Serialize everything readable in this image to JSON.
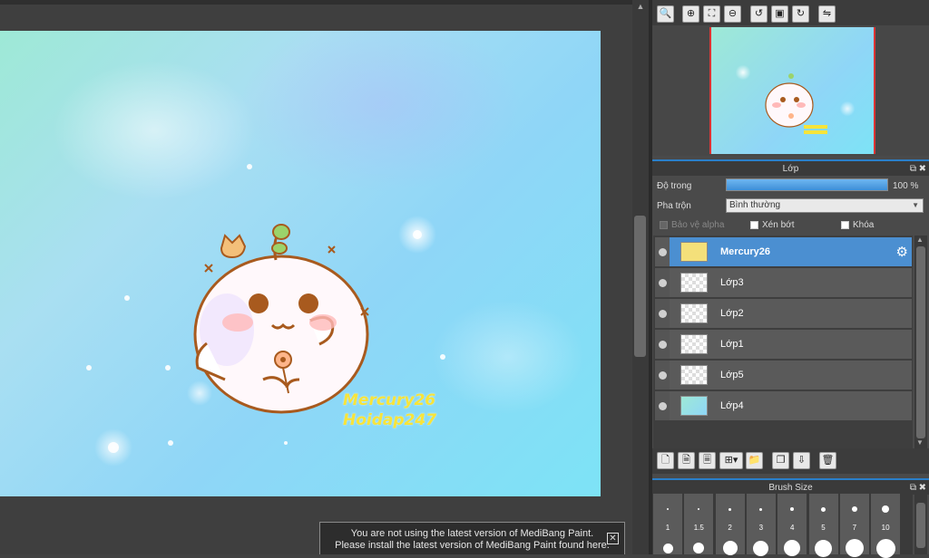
{
  "canvas": {
    "watermark_line1": "Mercury26",
    "watermark_line2": "Hoidap247",
    "background_colors": [
      "#9ee9d6",
      "#8fd6f7",
      "#7de3f6"
    ]
  },
  "navigator": {
    "tools": [
      {
        "name": "zoom-fit-icon",
        "glyph": "🔍"
      },
      {
        "name": "zoom-in-icon",
        "glyph": "⊕"
      },
      {
        "name": "fit-screen-icon",
        "glyph": "⛶"
      },
      {
        "name": "zoom-out-icon",
        "glyph": "⊖"
      },
      {
        "name": "rotate-left-icon",
        "glyph": "↺"
      },
      {
        "name": "actual-size-icon",
        "glyph": "▣"
      },
      {
        "name": "rotate-right-icon",
        "glyph": "↻"
      },
      {
        "name": "flip-icon",
        "glyph": "⇋"
      }
    ]
  },
  "layer_panel": {
    "title": "Lớp",
    "opacity_label": "Độ trong",
    "opacity_value": 100,
    "opacity_text": "100 %",
    "blend_label": "Pha trộn",
    "blend_value": "Bình thường",
    "protect_alpha_label": "Bảo vệ alpha",
    "clipping_label": "Xén bớt",
    "lock_label": "Khóa",
    "layers": [
      {
        "name": "Mercury26",
        "selected": true
      },
      {
        "name": "Lớp3",
        "selected": false
      },
      {
        "name": "Lớp2",
        "selected": false
      },
      {
        "name": "Lớp1",
        "selected": false
      },
      {
        "name": "Lớp5",
        "selected": false
      },
      {
        "name": "Lớp4",
        "selected": false
      }
    ],
    "tools": [
      {
        "name": "new-layer-icon",
        "glyph": "🗋"
      },
      {
        "name": "new-halftone-layer-icon",
        "glyph": "🗎"
      },
      {
        "name": "new-8bit-layer-icon",
        "glyph": "🗏"
      },
      {
        "name": "add-layer-menu-icon",
        "glyph": "⊞▾"
      },
      {
        "name": "folder-icon",
        "glyph": "📁"
      },
      {
        "name": "duplicate-layer-icon",
        "glyph": "❐"
      },
      {
        "name": "merge-down-icon",
        "glyph": "⇩"
      },
      {
        "name": "delete-layer-icon",
        "glyph": "🗑"
      }
    ]
  },
  "brush_size_panel": {
    "title": "Brush Size",
    "sizes": [
      {
        "label": "1",
        "dot": 2,
        "dot2": 11
      },
      {
        "label": "1.5",
        "dot": 2,
        "dot2": 12
      },
      {
        "label": "2",
        "dot": 3,
        "dot2": 16
      },
      {
        "label": "3",
        "dot": 3,
        "dot2": 17
      },
      {
        "label": "4",
        "dot": 4,
        "dot2": 18
      },
      {
        "label": "5",
        "dot": 5,
        "dot2": 19
      },
      {
        "label": "7",
        "dot": 6,
        "dot2": 20
      },
      {
        "label": "10",
        "dot": 8,
        "dot2": 21
      }
    ]
  },
  "notification": {
    "line1": "You are not using the latest version of MediBang Paint.",
    "line2": "Please install the latest version of MediBang Paint found here.",
    "close_glyph": "✕"
  },
  "panel_controls": {
    "float_glyph": "⧉",
    "close_glyph": "✖",
    "scroll_up_glyph": "▲",
    "scroll_down_glyph": "▼",
    "dropdown_glyph": "▼",
    "gear_glyph": "⚙"
  },
  "colors": {
    "accent": "#2a7fc9",
    "selected_layer": "#4b8fd1",
    "watermark": "#f7e43a"
  }
}
